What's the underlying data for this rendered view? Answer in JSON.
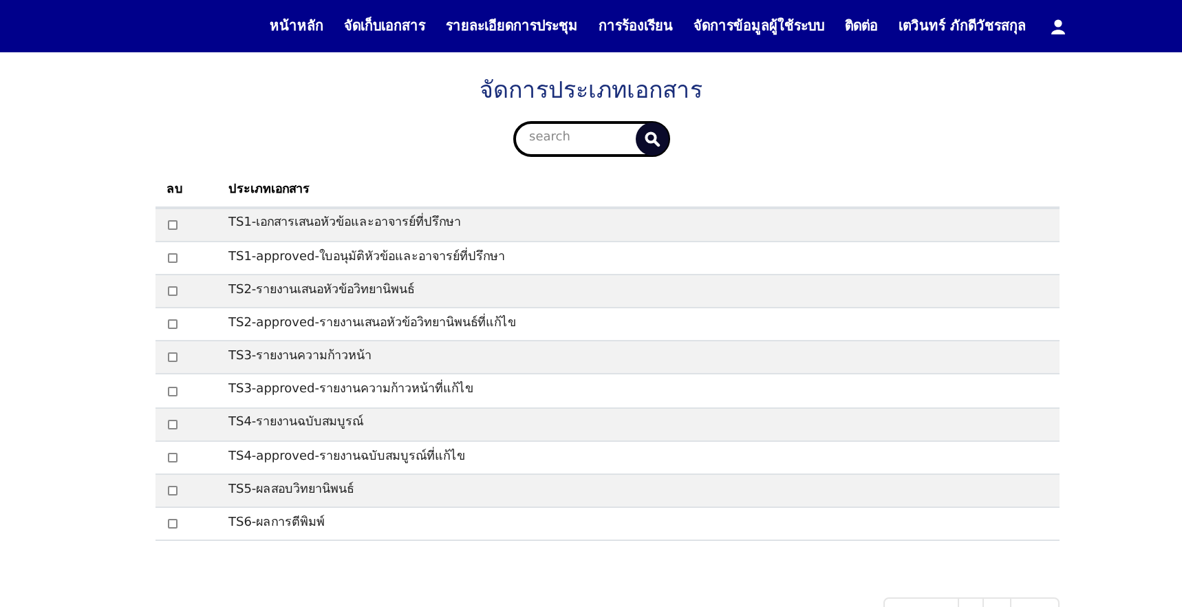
{
  "nav": {
    "items": [
      "หน้าหลัก",
      "จัดเก็บเอกสาร",
      "รายละเอียดการประชุม",
      "การร้องเรียน",
      "จัดการข้อมูลผู้ใช้ระบบ",
      "ติดต่อ",
      "เตวินทร์ ภักดีวัชรสกุล"
    ]
  },
  "title": "จัดการประเภทเอกสาร",
  "search": {
    "placeholder": "search"
  },
  "table": {
    "columns": [
      "ลบ",
      "ประเภทเอกสาร"
    ],
    "rows": [
      {
        "checked": false,
        "name": "TS1-เอกสารเสนอหัวข้อและอาจารย์ที่ปรึกษา"
      },
      {
        "checked": false,
        "name": "TS1-approved-ใบอนุมัติหัวข้อและอาจารย์ที่ปรึกษา"
      },
      {
        "checked": false,
        "name": "TS2-รายงานเสนอหัวข้อวิทยานิพนธ์"
      },
      {
        "checked": false,
        "name": "TS2-approved-รายงานเสนอหัวข้อวิทยานิพนธ์ที่แก้ไข"
      },
      {
        "checked": false,
        "name": "TS3-รายงานความก้าวหน้า"
      },
      {
        "checked": false,
        "name": "TS3-approved-รายงานความก้าวหน้าที่แก้ไข"
      },
      {
        "checked": false,
        "name": "TS4-รายงานฉบับสมบูรณ์"
      },
      {
        "checked": false,
        "name": "TS4-approved-รายงานฉบับสมบูรณ์ที่แก้ไข"
      },
      {
        "checked": false,
        "name": "TS5-ผลสอบวิทยานิพนธ์"
      },
      {
        "checked": false,
        "name": "TS6-ผลการตีพิมพ์"
      }
    ]
  }
}
